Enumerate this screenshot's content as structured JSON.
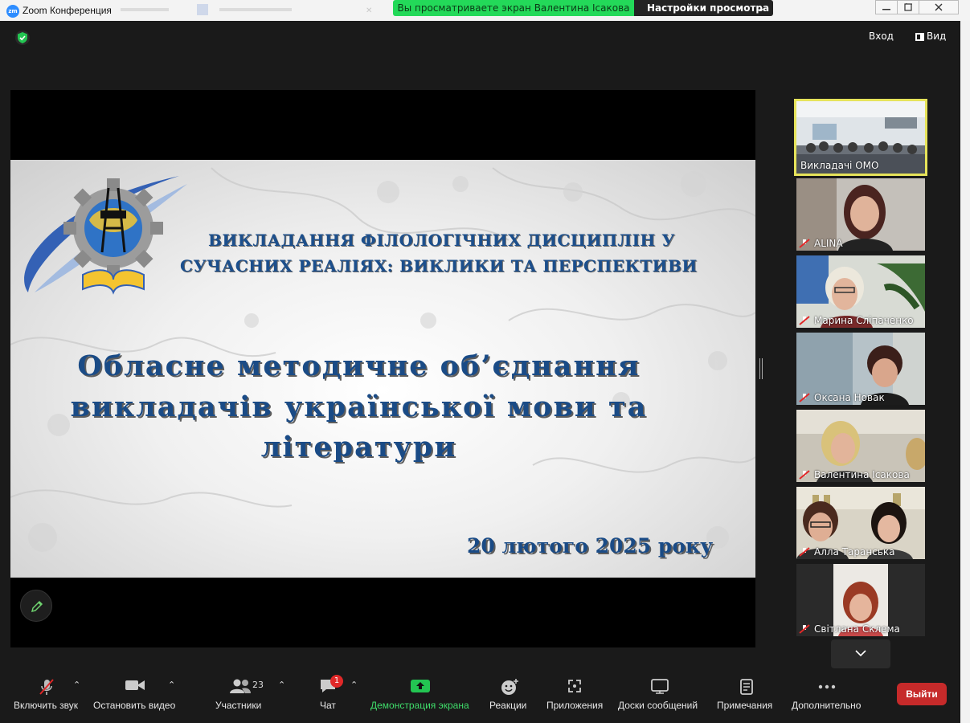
{
  "window": {
    "title": "Zoom Конференция",
    "app_icon": "zm",
    "share_banner": "Вы просматриваете экран Валентина Ісакова",
    "view_settings": "Настройки просмотра",
    "view_settings_icon": "chevron-down-icon"
  },
  "header": {
    "enter_label": "Вход",
    "view_label": "Вид"
  },
  "slide": {
    "header_line1": "ВИКЛАДАННЯ ФІЛОЛОГІЧНИХ ДИСЦИПЛІН У",
    "header_line2": "СУЧАСНИХ РЕАЛІЯХ: ВИКЛИКИ ТА ПЕРСПЕКТИВИ",
    "title_line1": "Обласне методичне об’єднання",
    "title_line2": "викладачів української мови та",
    "title_line3": "літератури",
    "date": "20 лютого 2025 року"
  },
  "gallery": {
    "participants": [
      {
        "name": "Викладачі ОМО",
        "muted": false,
        "active_speaker": true
      },
      {
        "name": "ALINA",
        "muted": true
      },
      {
        "name": "Марина Сліпаченко",
        "muted": true
      },
      {
        "name": "Оксана Новак",
        "muted": true
      },
      {
        "name": "Валентина Ісакова",
        "muted": true
      },
      {
        "name": "Алла Таранська",
        "muted": true
      },
      {
        "name": "Світлана Склема",
        "muted": true
      }
    ]
  },
  "toolbar": {
    "unmute_label": "Включить звук",
    "stop_video_label": "Остановить видео",
    "participants_label": "Участники",
    "participants_count": "23",
    "chat_label": "Чат",
    "chat_badge": "1",
    "share_screen_label": "Демонстрация экрана",
    "reactions_label": "Реакции",
    "apps_label": "Приложения",
    "whiteboards_label": "Доски сообщений",
    "notes_label": "Примечания",
    "more_label": "Дополнительно",
    "leave_label": "Выйти"
  },
  "colors": {
    "share_green": "#23d959",
    "leave_red": "#c62a2a",
    "active_speaker_border": "#e6e35a",
    "slide_text_blue": "#1c4f8c"
  }
}
